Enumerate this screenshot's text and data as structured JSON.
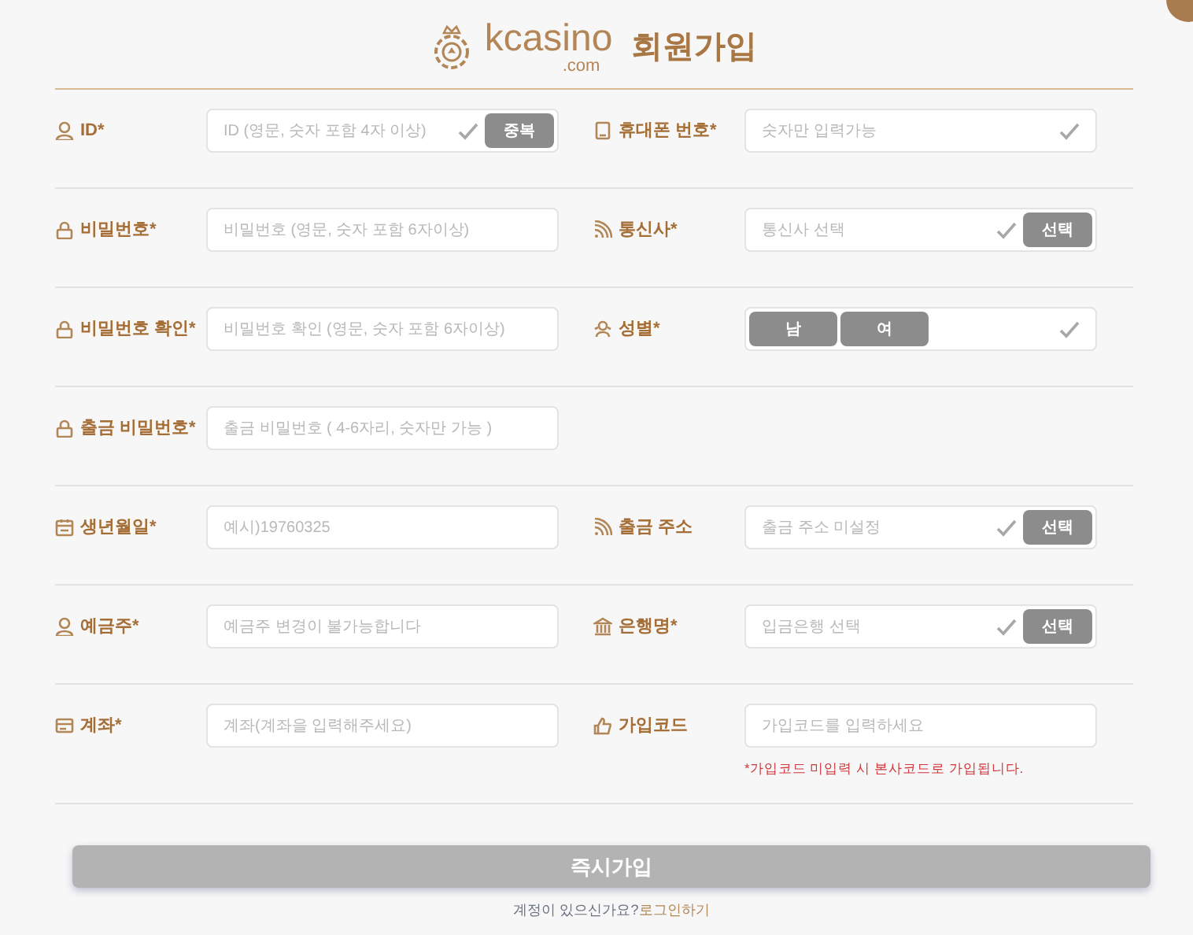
{
  "header": {
    "logo": "kcasino",
    "logo_suffix": ".com",
    "title": "회원가입"
  },
  "rows": [
    {
      "left": {
        "kind": "text",
        "label": "ID*",
        "placeholder": "ID (영문, 숫자 포함 4자 이상)",
        "checkmark": true,
        "button": "중복"
      },
      "right": {
        "kind": "text",
        "label": "휴대폰 번호*",
        "placeholder": "숫자만 입력가능",
        "checkmark": true
      }
    },
    {
      "left": {
        "kind": "text",
        "label": "비밀번호*",
        "placeholder": "비밀번호 (영문, 숫자 포함 6자이상)",
        "checkmark": false
      },
      "right": {
        "kind": "text",
        "label": "통신사*",
        "placeholder": "통신사 선택",
        "checkmark": true,
        "button": "선택"
      }
    },
    {
      "left": {
        "kind": "text",
        "label": "비밀번호 확인*",
        "placeholder": "비밀번호 확인 (영문, 숫자 포함 6자이상)",
        "checkmark": false
      },
      "right": {
        "kind": "choice",
        "label": "성별*",
        "checkmark": true,
        "options": [
          {
            "label": "남",
            "selected": false
          },
          {
            "label": "여",
            "selected": false
          }
        ]
      }
    },
    {
      "left": {
        "kind": "text",
        "label": "출금 비밀번호*",
        "placeholder": "출금 비밀번호 ( 4-6자리, 숫자만 가능 )",
        "checkmark": false
      }
    },
    {
      "left": {
        "kind": "text",
        "label": "생년월일*",
        "placeholder": "예시)19760325",
        "checkmark": false
      },
      "right": {
        "kind": "text",
        "label": "출금 주소",
        "placeholder": "출금 주소 미설정",
        "checkmark": true,
        "button": "선택"
      }
    },
    {
      "left": {
        "kind": "text",
        "label": "예금주*",
        "placeholder": "예금주 변경이 불가능합니다",
        "checkmark": false
      },
      "right": {
        "kind": "text",
        "label": "은행명*",
        "placeholder": "입금은행 선택",
        "checkmark": true,
        "button": "선택"
      }
    },
    {
      "left": {
        "kind": "text",
        "label": "계좌*",
        "placeholder": "계좌(계좌을 입력해주세요)",
        "checkmark": false
      },
      "right": {
        "kind": "text",
        "label": "가입코드",
        "placeholder": "가입코드를 입력하세요",
        "checkmark": false,
        "note": "*가입코드 미입력 시 본사코드로 가입됩니다."
      }
    }
  ],
  "submit": "즉시가입",
  "login_prompt": {
    "text": "계정이 있으신가요?",
    "link": "로그인하기"
  }
}
